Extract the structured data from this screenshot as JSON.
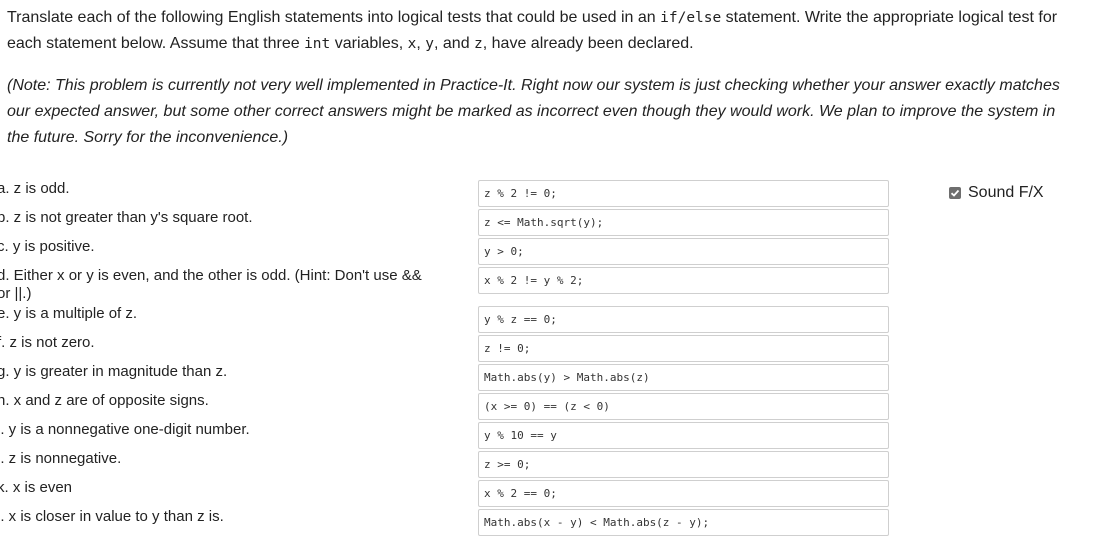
{
  "intro": {
    "part1": "Translate each of the following English statements into logical tests that could be used in an ",
    "code1": "if/else",
    "part2": " statement. Write the appropriate logical test for each statement below. Assume that three ",
    "code2": "int",
    "part3": " variables, ",
    "var_x": "x",
    "sep1": ", ",
    "var_y": "y",
    "sep2": ", and ",
    "var_z": "z",
    "part4": ", have already been declared."
  },
  "note": "(Note: This problem is currently not very well implemented in Practice-It. Right now our system is just checking whether your answer exactly matches our expected answer, but some other correct answers might be marked as incorrect even though they would work. We plan to improve the system in the future. Sorry for the inconvenience.)",
  "sound_fx": {
    "label": "Sound F/X",
    "checked": true
  },
  "questions": [
    {
      "label": "a. z is odd.",
      "answer": "z % 2 != 0;"
    },
    {
      "label": "b. z is not greater than y's square root.",
      "answer": "z <= Math.sqrt(y);"
    },
    {
      "label": "c. y is positive.",
      "answer": "y > 0;"
    },
    {
      "label": "d. Either x or y is even, and the other is odd. (Hint: Don't use && or ||.)",
      "answer": "x % 2 != y % 2;"
    },
    {
      "label": "e. y is a multiple of z.",
      "answer": "y % z == 0;"
    },
    {
      "label": "f. z is not zero.",
      "answer": "z != 0;"
    },
    {
      "label": "g. y is greater in magnitude than z.",
      "answer": "Math.abs(y) > Math.abs(z)"
    },
    {
      "label": "h. x and z are of opposite signs.",
      "answer": "(x >= 0) == (z < 0)"
    },
    {
      "label": "i. y is a nonnegative one-digit number.",
      "answer": "y % 10 == y"
    },
    {
      "label": "j. z is nonnegative.",
      "answer": "z >= 0;"
    },
    {
      "label": "k. x is even",
      "answer": "x % 2 == 0;"
    },
    {
      "label": "l. x is closer in value to y than z is.",
      "answer": "Math.abs(x - y) < Math.abs(z - y);"
    }
  ]
}
